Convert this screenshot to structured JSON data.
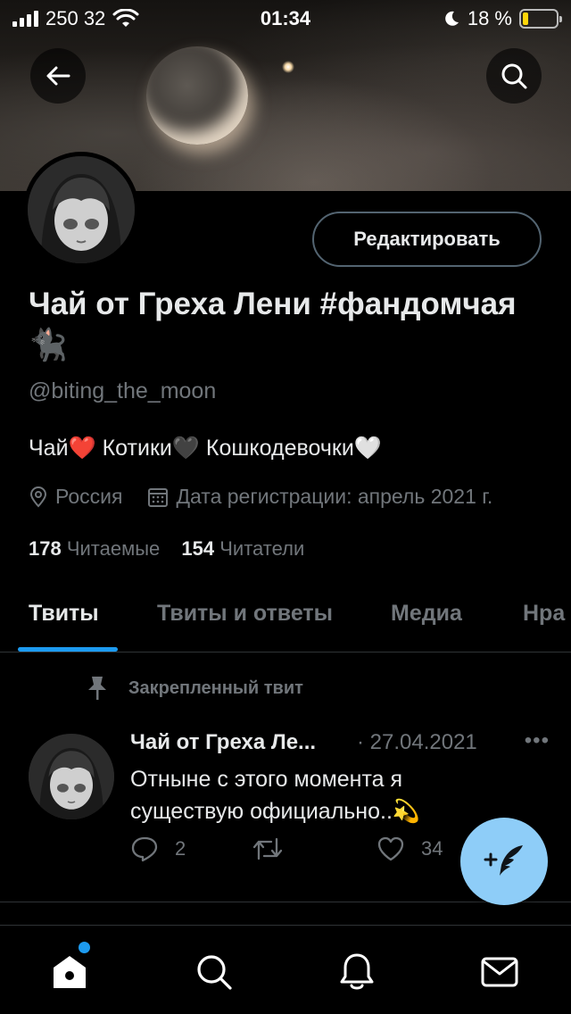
{
  "status_bar": {
    "carrier": "250 32",
    "time": "01:34",
    "battery_percent": "18 %",
    "battery_level": 0.18
  },
  "header": {
    "back_icon": "arrow-left-icon",
    "search_icon": "search-icon"
  },
  "profile": {
    "edit_button_label": "Редактировать",
    "name": "Чай от Греха Лени #фандомчая🐈‍⬛",
    "handle": "@biting_the_moon",
    "bio": "Чай❤️ Котики🖤 Кошкодевочки🤍",
    "location": "Россия",
    "joined": "Дата регистрации: апрель 2021 г.",
    "following_count": "178",
    "following_label": "Читаемые",
    "followers_count": "154",
    "followers_label": "Читатели"
  },
  "tabs": [
    {
      "label": "Твиты",
      "active": true
    },
    {
      "label": "Твиты и ответы",
      "active": false
    },
    {
      "label": "Медиа",
      "active": false
    },
    {
      "label": "Нра",
      "active": false
    }
  ],
  "tweet": {
    "pinned_label": "Закрепленный твит",
    "author": "Чай от Греха Ле...",
    "date": "· 27.04.2021",
    "more": "•••",
    "text": "Отныне с этого момента я существую официально..💫",
    "reply_count": "2",
    "retweet_count": "",
    "like_count": "34"
  },
  "fab": {
    "icon": "compose-tweet-icon"
  },
  "bottom_nav": [
    {
      "name": "home",
      "icon": "home-icon",
      "has_notification_dot": true
    },
    {
      "name": "search",
      "icon": "search-icon"
    },
    {
      "name": "notifications",
      "icon": "bell-icon"
    },
    {
      "name": "messages",
      "icon": "mail-icon"
    }
  ],
  "colors": {
    "background": "#000000",
    "text_primary": "#e7e9ea",
    "text_secondary": "#71767b",
    "accent": "#1d9bf0",
    "fab": "#8ecdf8",
    "battery": "#ffd60a"
  }
}
